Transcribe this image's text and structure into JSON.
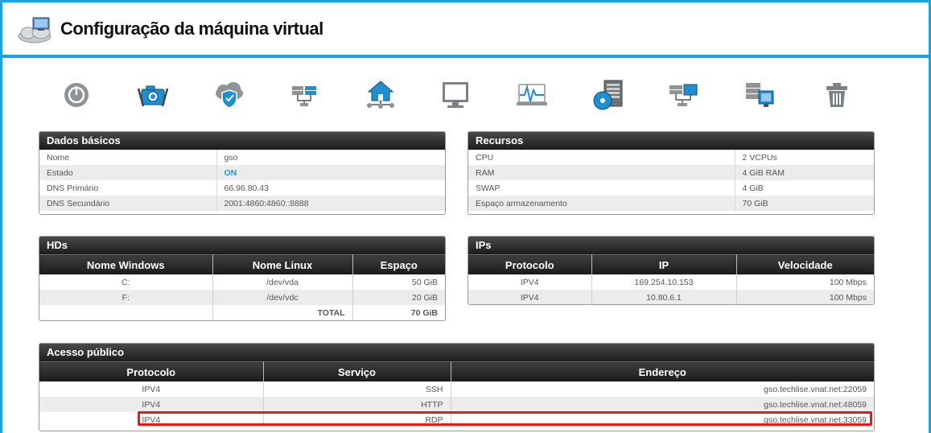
{
  "page": {
    "title": "Configuração da máquina virtual"
  },
  "toolbar": {
    "icons": [
      "power-icon",
      "snapshot-icon",
      "firewall-icon",
      "network-icon",
      "home-network-icon",
      "console-icon",
      "monitoring-icon",
      "disk-icon",
      "network-config-icon",
      "migrate-icon",
      "delete-icon"
    ]
  },
  "basic": {
    "title": "Dados básicos",
    "rows": [
      {
        "label": "Nome",
        "value": "gso"
      },
      {
        "label": "Estado",
        "value": "ON"
      },
      {
        "label": "DNS Primário",
        "value": "66.96.80.43"
      },
      {
        "label": "DNS Secundário",
        "value": "2001:4860:4860::8888"
      }
    ]
  },
  "resources": {
    "title": "Recursos",
    "rows": [
      {
        "label": "CPU",
        "value": "2 VCPUs"
      },
      {
        "label": "RAM",
        "value": "4 GiB RAM"
      },
      {
        "label": "SWAP",
        "value": "4 GiB"
      },
      {
        "label": "Espaço armazenamento",
        "value": "70 GiB"
      }
    ]
  },
  "hds": {
    "title": "HDs",
    "columns": [
      "Nome Windows",
      "Nome Linux",
      "Espaço"
    ],
    "rows": [
      {
        "windows": "C:",
        "linux": "/dev/vda",
        "size": "50 GiB"
      },
      {
        "windows": "F:",
        "linux": "/dev/vdc",
        "size": "20 GiB"
      }
    ],
    "total_label": "TOTAL",
    "total_value": "70 GiB"
  },
  "ips": {
    "title": "IPs",
    "columns": [
      "Protocolo",
      "IP",
      "Velocidade"
    ],
    "rows": [
      {
        "protocol": "IPV4",
        "ip": "169.254.10.153",
        "speed": "100 Mbps"
      },
      {
        "protocol": "IPV4",
        "ip": "10.80.6.1",
        "speed": "100 Mbps"
      }
    ]
  },
  "public": {
    "title": "Acesso público",
    "columns": [
      "Protocolo",
      "Serviço",
      "Endereço"
    ],
    "rows": [
      {
        "protocol": "IPV4",
        "service": "SSH",
        "address": "gso.techlise.vnat.net:22059"
      },
      {
        "protocol": "IPV4",
        "service": "HTTP",
        "address": "gso.techlise.vnat.net:48059"
      },
      {
        "protocol": "IPV4",
        "service": "RDP",
        "address": "gso.techlise.vnat.net:33059"
      }
    ],
    "highlighted_row": 2
  },
  "colors": {
    "accent": "#1aa3dc",
    "highlight": "#e21b1b",
    "status_on": "#1a9fd8"
  }
}
